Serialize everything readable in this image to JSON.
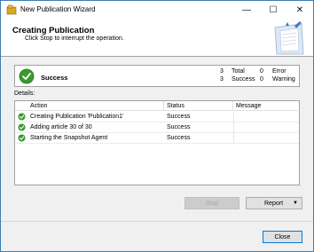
{
  "window": {
    "title": "New Publication Wizard",
    "minimize_icon": "—",
    "maximize_icon": "☐",
    "close_icon": "✕"
  },
  "header": {
    "title": "Creating Publication",
    "subtitle": "Click Stop to interrupt the operation."
  },
  "summary": {
    "status": "Success",
    "total_count": "3",
    "total_label": "Total",
    "success_count": "3",
    "success_label": "Success",
    "error_count": "0",
    "error_label": "Error",
    "warning_count": "0",
    "warning_label": "Warning"
  },
  "details": {
    "label": "Details:",
    "columns": [
      "Action",
      "Status",
      "Message"
    ],
    "rows": [
      {
        "action": "Creating Publication 'Publication1'",
        "status": "Success",
        "message": ""
      },
      {
        "action": "Adding article 30 of 30",
        "status": "Success",
        "message": ""
      },
      {
        "action": "Starting the Snapshot Agent",
        "status": "Success",
        "message": ""
      }
    ]
  },
  "buttons": {
    "stop": "Stop",
    "report": "Report",
    "report_arrow": "▼",
    "close": "Close"
  },
  "colors": {
    "success_green": "#3a9a2e",
    "accent_blue": "#0078d7"
  }
}
